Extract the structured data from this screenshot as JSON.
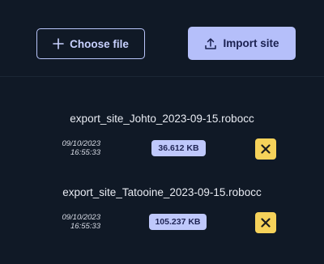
{
  "toolbar": {
    "choose_file_label": "Choose file",
    "import_site_label": "Import site"
  },
  "files": [
    {
      "name": "export_site_Johto_2023-09-15.robocc",
      "date": "09/10/2023",
      "time": "16:55:33",
      "size": "36.612 KB"
    },
    {
      "name": "export_site_Tatooine_2023-09-15.robocc",
      "date": "09/10/2023",
      "time": "16:55:33",
      "size": "105.237 KB"
    }
  ],
  "icons": {
    "choose": "plus-icon",
    "import": "upload-icon",
    "remove": "close-icon"
  },
  "colors": {
    "background": "#101926",
    "accent": "#b5bffa",
    "badge": "#bfc8fb",
    "remove": "#f6d25a"
  }
}
